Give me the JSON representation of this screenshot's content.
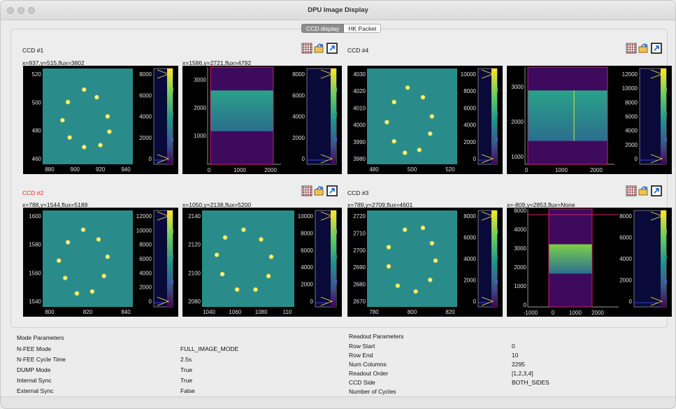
{
  "window": {
    "title": "DPU Image Display"
  },
  "tabs": [
    {
      "label": "CCD display"
    },
    {
      "label": "HK Packet"
    }
  ],
  "ccd_panels": {
    "ccd1": {
      "title": "CCD #1",
      "title_color": "#111111",
      "coord_left": "x=937,y=515,flux=3802",
      "coord_right": "x=1586,y=2721,flux=4792",
      "left_image": {
        "x_ticks": [
          "880",
          "900",
          "920",
          "940"
        ],
        "y_ticks": [
          "520",
          "500",
          "480",
          "460"
        ],
        "colorbar_ticks": [
          "8000",
          "6000",
          "4000",
          "2000",
          "0"
        ]
      },
      "right_image": {
        "x_ticks": [
          "0",
          "1000",
          "2000"
        ],
        "y_ticks": [
          "3000",
          "2000",
          "1000"
        ],
        "colorbar_ticks": [
          "8000",
          "6000",
          "4000",
          "2000",
          "0"
        ]
      }
    },
    "ccd4": {
      "title": "CCD #4",
      "title_color": "#111111",
      "coord_left": "",
      "coord_right": "",
      "left_image": {
        "x_ticks": [
          "480",
          "500",
          "520"
        ],
        "y_ticks": [
          "4030",
          "4020",
          "4010",
          "4000",
          "3990",
          "3980"
        ],
        "colorbar_ticks": [
          "10000",
          "8000",
          "6000",
          "4000",
          "2000",
          "0"
        ]
      },
      "right_image": {
        "x_ticks": [
          "0",
          "1000",
          "2000"
        ],
        "y_ticks": [
          "3000",
          "2000",
          "1000"
        ],
        "colorbar_ticks": [
          "12000",
          "10000",
          "8000",
          "6000",
          "4000",
          "2000",
          "0"
        ]
      }
    },
    "ccd2": {
      "title": "CCD #2",
      "title_color": "#e52525",
      "coord_left": "x=788,y=1544,flux=5189",
      "coord_right": "x=1050,y=2138,flux=5200",
      "left_image": {
        "x_ticks": [
          "800",
          "820",
          "840"
        ],
        "y_ticks": [
          "1600",
          "1580",
          "1560",
          "1540"
        ],
        "colorbar_ticks": [
          "12000",
          "10000",
          "8000",
          "6000",
          "4000",
          "2000",
          "0"
        ]
      },
      "right_image": {
        "x_ticks": [
          "1040",
          "1060",
          "1080",
          "110"
        ],
        "y_ticks": [
          "2140",
          "2120",
          "2100",
          "2080"
        ],
        "colorbar_ticks": [
          "10000",
          "8000",
          "6000",
          "4000",
          "2000",
          "0"
        ]
      }
    },
    "ccd3": {
      "title": "CCD #3",
      "title_color": "#111111",
      "coord_left": "x=789,y=2709,flux=4601",
      "coord_right": "x=-809,y=2853,flux=None",
      "left_image": {
        "x_ticks": [
          "780",
          "800",
          "820"
        ],
        "y_ticks": [
          "2720",
          "2710",
          "2700",
          "2690",
          "2680",
          "2670"
        ],
        "colorbar_ticks": [
          "8000",
          "6000",
          "4000",
          "2000",
          "0"
        ]
      },
      "right_image": {
        "x_ticks": [
          "-1000",
          "0",
          "1000",
          "2000"
        ],
        "y_ticks": [
          "8000",
          "4000",
          "3000",
          "2000",
          "1000",
          "0"
        ],
        "colorbar_ticks": [
          "8000",
          "6000",
          "4000",
          "2000",
          "0"
        ]
      }
    }
  },
  "mode_parameters": {
    "heading": "Mode Parameters",
    "rows": [
      {
        "name": "N-FEE Mode",
        "value": "FULL_IMAGE_MODE"
      },
      {
        "name": "N-FEE Cycle Time",
        "value": "2.5s"
      },
      {
        "name": "DUMP Mode",
        "value": "True"
      },
      {
        "name": "Internal Sync",
        "value": "True"
      },
      {
        "name": "External Sync",
        "value": "False"
      }
    ]
  },
  "readout_parameters": {
    "heading": "Readout Parameters",
    "rows": [
      {
        "name": "Row Start",
        "value": "0"
      },
      {
        "name": "Row End",
        "value": "10"
      },
      {
        "name": "Num Columns",
        "value": "2295"
      },
      {
        "name": "Readout Order",
        "value": "[1,2,3,4]"
      },
      {
        "name": "CCD Side",
        "value": "BOTH_SIDES"
      },
      {
        "name": "Number of Cycles",
        "value": ""
      }
    ]
  },
  "colors": {
    "image_bg": "#2a8c8a",
    "spot": "#f5e53b",
    "band_purple": "#3d0a5e",
    "roi_border": "#e0206a",
    "gradient_top": "#28a586",
    "gradient_bottom": "#2b6e8e"
  },
  "icons": {
    "grid": "grid-icon",
    "save": "save-image-icon",
    "popout": "popout-icon"
  }
}
